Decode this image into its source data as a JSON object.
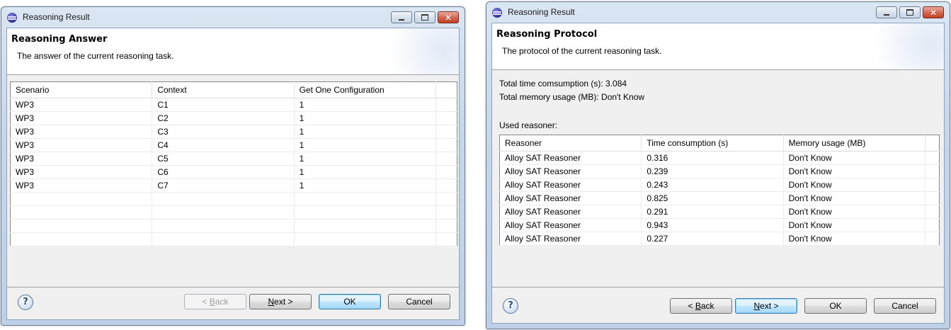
{
  "left_dialog": {
    "window_title": "Reasoning Result",
    "header_title": "Reasoning Answer",
    "header_description": "The answer of the current reasoning task.",
    "table": {
      "columns": [
        "Scenario",
        "Context",
        "Get One Configuration"
      ],
      "rows": [
        [
          "WP3",
          "C1",
          "1"
        ],
        [
          "WP3",
          "C2",
          "1"
        ],
        [
          "WP3",
          "C3",
          "1"
        ],
        [
          "WP3",
          "C4",
          "1"
        ],
        [
          "WP3",
          "C5",
          "1"
        ],
        [
          "WP3",
          "C6",
          "1"
        ],
        [
          "WP3",
          "C7",
          "1"
        ]
      ]
    },
    "buttons": {
      "back_prefix": "< ",
      "back_mnemonic": "B",
      "back_rest": "ack",
      "next_mnemonic": "N",
      "next_rest": "ext >",
      "ok": "OK",
      "cancel": "Cancel"
    },
    "back_enabled": false
  },
  "right_dialog": {
    "window_title": "Reasoning Result",
    "header_title": "Reasoning Protocol",
    "header_description": "The protocol of the current reasoning task.",
    "total_time": "Total time comsumption (s): 3.084",
    "total_memory": "Total memory usage (MB): Don't Know",
    "used_reasoner_label": "Used reasoner:",
    "table": {
      "columns": [
        "Reasoner",
        "Time consumption (s)",
        "Memory usage (MB)"
      ],
      "rows": [
        [
          "Alloy SAT Reasoner",
          "0.316",
          "Don't Know"
        ],
        [
          "Alloy SAT Reasoner",
          "0.239",
          "Don't Know"
        ],
        [
          "Alloy SAT Reasoner",
          "0.243",
          "Don't Know"
        ],
        [
          "Alloy SAT Reasoner",
          "0.825",
          "Don't Know"
        ],
        [
          "Alloy SAT Reasoner",
          "0.291",
          "Don't Know"
        ],
        [
          "Alloy SAT Reasoner",
          "0.943",
          "Don't Know"
        ],
        [
          "Alloy SAT Reasoner",
          "0.227",
          "Don't Know"
        ]
      ]
    },
    "buttons": {
      "back_prefix": "< ",
      "back_mnemonic": "B",
      "back_rest": "ack",
      "next_mnemonic": "N",
      "next_rest": "ext >",
      "ok": "OK",
      "cancel": "Cancel"
    },
    "back_enabled": true
  },
  "help_glyph": "?",
  "icons": {
    "title": "eclipse-icon",
    "minimize": "minimize-icon",
    "maximize": "maximize-icon",
    "close": "close-icon",
    "help": "help-icon"
  }
}
